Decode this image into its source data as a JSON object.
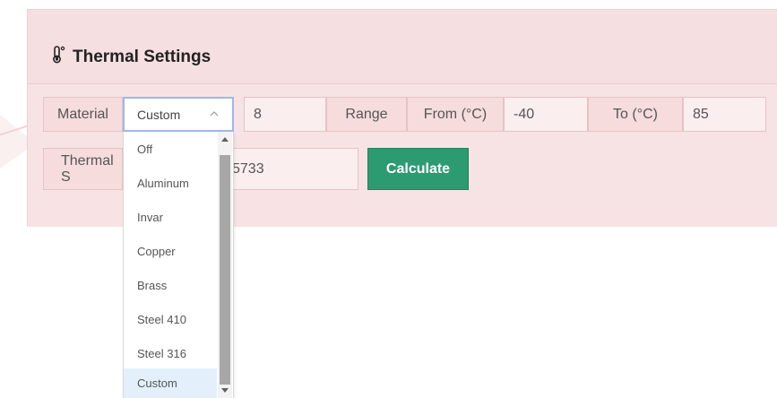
{
  "panel": {
    "title": "Thermal Settings"
  },
  "row1": {
    "material_label": "Material",
    "material_value": "Custom",
    "custom_input_value": "8",
    "range_label": "Range",
    "from_label": "From (°C)",
    "from_value": "-40",
    "to_label": "To (°C)",
    "to_value": "85"
  },
  "row2": {
    "thermal_label_visible": "Thermal S",
    "thermal_value_visible": "5733",
    "calculate_button": "Calculate"
  },
  "dropdown": {
    "options": [
      "Off",
      "Aluminum",
      "Invar",
      "Copper",
      "Brass",
      "Steel 410",
      "Steel 316",
      "Custom"
    ],
    "selected": "Custom"
  },
  "colors": {
    "panel_bg": "#f8e3e4",
    "accent_button": "#2c9b72",
    "select_focus_border": "#9fb7e6",
    "selected_option_bg": "#e3f0fc"
  },
  "icons": {
    "title_icon": "thermometer-icon",
    "select_chevron": "chevron-up-icon"
  }
}
